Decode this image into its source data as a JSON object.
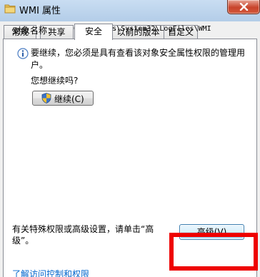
{
  "window": {
    "title": "WMI 属性"
  },
  "tabs": [
    {
      "label": "常规"
    },
    {
      "label": "共享"
    },
    {
      "label": "安全"
    },
    {
      "label": "以前的版本"
    },
    {
      "label": "自定义"
    }
  ],
  "security": {
    "object_name_label": "对象名称：",
    "object_name_value": "C:\\Windows\\System32\\LogFiles\\WMI",
    "info_message": "要继续，您必须是具有查看该对象安全属性权限的管理用户。",
    "question": "您想继续吗?",
    "continue_button": "继续(C)",
    "special_permissions_text": "有关特殊权限或高级设置，请单击“高级”。",
    "advanced_button": "高级(V)",
    "learn_link": "了解访问控制和权限"
  },
  "colors": {
    "highlight_box": "#ee0000",
    "link": "#0066cc"
  }
}
